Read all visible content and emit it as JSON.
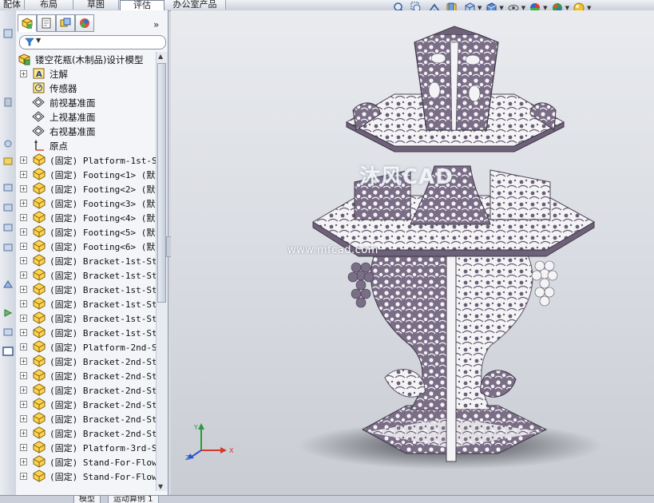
{
  "top_tabs": [
    {
      "label": "配体"
    },
    {
      "label": "布局"
    },
    {
      "label": "草图"
    },
    {
      "label": "评估",
      "active": true
    },
    {
      "label": "办公室产品"
    }
  ],
  "heads_up_toolbar": [
    "zoom-to-fit-icon",
    "zoom-area-icon",
    "previous-view-icon",
    "section-view-icon",
    "view-orientation-icon",
    "display-style-icon",
    "hide-show-icon",
    "appearance-icon",
    "scene-icon",
    "render-icon"
  ],
  "feature_tabs": [
    "feature-manager-icon",
    "property-manager-icon",
    "configuration-manager-icon",
    "display-manager-icon"
  ],
  "tree": {
    "root": "镂空花瓶(木制品)设计模型",
    "items": [
      {
        "label": "注解",
        "icon": "annotation-icon",
        "expandable": true
      },
      {
        "label": "传感器",
        "icon": "sensor-icon",
        "expandable": false
      },
      {
        "label": "前视基准面",
        "icon": "plane-icon",
        "expandable": false
      },
      {
        "label": "上视基准面",
        "icon": "plane-icon",
        "expandable": false
      },
      {
        "label": "右视基准面",
        "icon": "plane-icon",
        "expandable": false
      },
      {
        "label": "原点",
        "icon": "origin-icon",
        "expandable": false
      },
      {
        "label": "(固定) Platform-1st-St",
        "icon": "part-icon",
        "expandable": true
      },
      {
        "label": "(固定) Footing<1> (默认",
        "icon": "part-icon",
        "expandable": true
      },
      {
        "label": "(固定) Footing<2> (默认",
        "icon": "part-icon",
        "expandable": true
      },
      {
        "label": "(固定) Footing<3> (默认",
        "icon": "part-icon",
        "expandable": true
      },
      {
        "label": "(固定) Footing<4> (默认",
        "icon": "part-icon",
        "expandable": true
      },
      {
        "label": "(固定) Footing<5> (默认",
        "icon": "part-icon",
        "expandable": true
      },
      {
        "label": "(固定) Footing<6> (默认",
        "icon": "part-icon",
        "expandable": true
      },
      {
        "label": "(固定) Bracket-1st-Sta",
        "icon": "part-icon",
        "expandable": true
      },
      {
        "label": "(固定) Bracket-1st-Sta",
        "icon": "part-icon",
        "expandable": true
      },
      {
        "label": "(固定) Bracket-1st-Sta",
        "icon": "part-icon",
        "expandable": true
      },
      {
        "label": "(固定) Bracket-1st-Sta",
        "icon": "part-icon",
        "expandable": true
      },
      {
        "label": "(固定) Bracket-1st-Sta",
        "icon": "part-icon",
        "expandable": true
      },
      {
        "label": "(固定) Bracket-1st-Sta",
        "icon": "part-icon",
        "expandable": true
      },
      {
        "label": "(固定) Platform-2nd-St",
        "icon": "part-icon",
        "expandable": true
      },
      {
        "label": "(固定) Bracket-2nd-Sta",
        "icon": "part-icon",
        "expandable": true
      },
      {
        "label": "(固定) Bracket-2nd-Sta",
        "icon": "part-icon",
        "expandable": true
      },
      {
        "label": "(固定) Bracket-2nd-Sta",
        "icon": "part-icon",
        "expandable": true
      },
      {
        "label": "(固定) Bracket-2nd-Sta",
        "icon": "part-icon",
        "expandable": true
      },
      {
        "label": "(固定) Bracket-2nd-Sta",
        "icon": "part-icon",
        "expandable": true
      },
      {
        "label": "(固定) Bracket-2nd-Sta",
        "icon": "part-icon",
        "expandable": true
      },
      {
        "label": "(固定) Platform-3rd-St",
        "icon": "part-icon",
        "expandable": true
      },
      {
        "label": "(固定) Stand-For-Flowe",
        "icon": "part-icon",
        "expandable": true
      },
      {
        "label": "(固定) Stand-For-Flowe",
        "icon": "part-icon",
        "expandable": true
      }
    ]
  },
  "viewport": {
    "watermark_logo": "沐风CAD",
    "watermark_url": "www.mfcad.com",
    "triad_labels": {
      "x": "X",
      "y": "Y",
      "z": "Z"
    }
  },
  "bottom_tabs": [
    {
      "label": "模型"
    },
    {
      "label": "运动算例 1"
    }
  ],
  "colors": {
    "model_purple": "#7a6d86",
    "model_white": "#f4f4f6",
    "viewport_bg": "#dcdfe4",
    "panel_bg": "#f3f5f9"
  }
}
